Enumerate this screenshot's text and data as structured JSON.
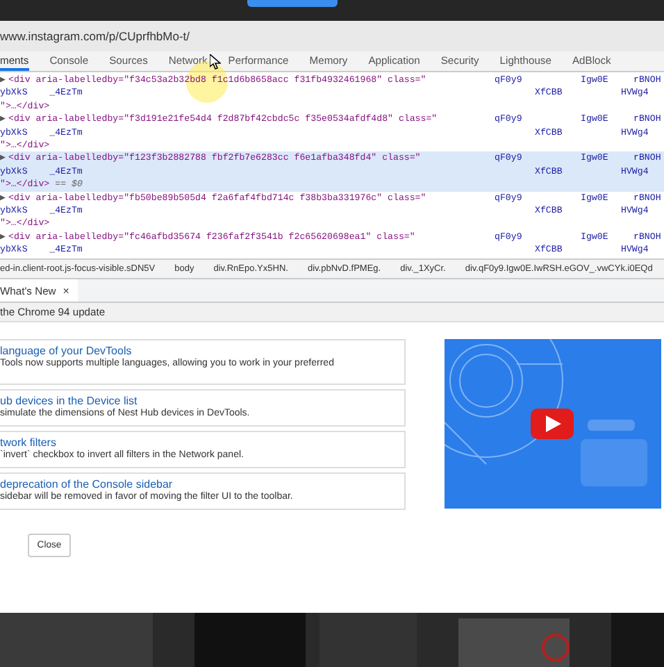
{
  "address_bar": {
    "url": "www.instagram.com/p/CUprfhbMo-t/"
  },
  "tabs": [
    {
      "label": "ments",
      "selected": true
    },
    {
      "label": "Console",
      "selected": false
    },
    {
      "label": "Sources",
      "selected": false
    },
    {
      "label": "Network",
      "selected": false
    },
    {
      "label": "Performance",
      "selected": false
    },
    {
      "label": "Memory",
      "selected": false
    },
    {
      "label": "Application",
      "selected": false
    },
    {
      "label": "Security",
      "selected": false
    },
    {
      "label": "Lighthouse",
      "selected": false
    },
    {
      "label": "AdBlock",
      "selected": false
    }
  ],
  "elements": [
    {
      "toggle": "▶",
      "line1": "<div aria-labelledby=\"f34c53a2b32bd8 f1c1d6b8658acc f31fb4932461968\" class=\"",
      "class_1": "qF0y9",
      "class_2": "Igw0E",
      "class_3": "rBNOH",
      "line2": "ybXkS    _4EzTm",
      "class_4": "XfCBB",
      "class_5": "HVWg4",
      "line3": "\">…</div>",
      "selected": false
    },
    {
      "toggle": "▶",
      "line1": "<div aria-labelledby=\"f3d191e21fe54d4 f2d87bf42cbdc5c f35e0534afdf4d8\" class=\"",
      "class_1": "qF0y9",
      "class_2": "Igw0E",
      "class_3": "rBNOH",
      "line2": "ybXkS    _4EzTm",
      "class_4": "XfCBB",
      "class_5": "HVWg4",
      "line3": "\">…</div>",
      "selected": false
    },
    {
      "toggle": "▶",
      "line1": "<div aria-labelledby=\"f123f3b2882788 fbf2fb7e6283cc f6e1afba348fd4\" class=\"",
      "class_1": "qF0y9",
      "class_2": "Igw0E",
      "class_3": "rBNOH",
      "line2": "ybXkS    _4EzTm",
      "class_4": "XfCBB",
      "class_5": "HVWg4",
      "line3": "\">…</div>",
      "ref": "== $0",
      "selected": true
    },
    {
      "toggle": "▶",
      "line1": "<div aria-labelledby=\"fb50be89b505d4 f2a6faf4fbd714c f38b3ba331976c\" class=\"",
      "class_1": "qF0y9",
      "class_2": "Igw0E",
      "class_3": "rBNOH",
      "line2": "ybXkS    _4EzTm",
      "class_4": "XfCBB",
      "class_5": "HVWg4",
      "line3": "\">…</div>",
      "selected": false
    },
    {
      "toggle": "▶",
      "line1": "<div aria-labelledby=\"fc46afbd35674 f236faf2f3541b f2c65620698ea1\" class=\"",
      "class_1": "qF0y9",
      "class_2": "Igw0E",
      "class_3": "rBNOH",
      "line2": "ybXkS    _4EzTm",
      "class_4": "XfCBB",
      "class_5": "HVWg4",
      "selected": false
    }
  ],
  "breadcrumbs": [
    "ed-in.client-root.js-focus-visible.sDN5V",
    "body",
    "div.RnEpo.Yx5HN.",
    "div.pbNvD.fPMEg.",
    "div._1XyCr.",
    "div.qF0y9.Igw0E.IwRSH.eGOV_.vwCYk.i0EQd"
  ],
  "drawer_tabs": [
    {
      "label": "What's New",
      "close": "×",
      "selected": true
    }
  ],
  "drawer_header": "the Chrome 94 update",
  "cards": [
    {
      "title": "language of your DevTools",
      "text": "Tools now supports multiple languages, allowing you to work in your preferred"
    },
    {
      "title": "ub devices in the Device list",
      "text": "simulate the dimensions of Nest Hub devices in DevTools."
    },
    {
      "title": "twork filters",
      "text": "`invert` checkbox to invert all filters in the Network panel."
    },
    {
      "title": "deprecation of the Console sidebar",
      "text": "sidebar will be removed in favor of moving the filter UI to the toolbar."
    }
  ],
  "close_button": "Close"
}
